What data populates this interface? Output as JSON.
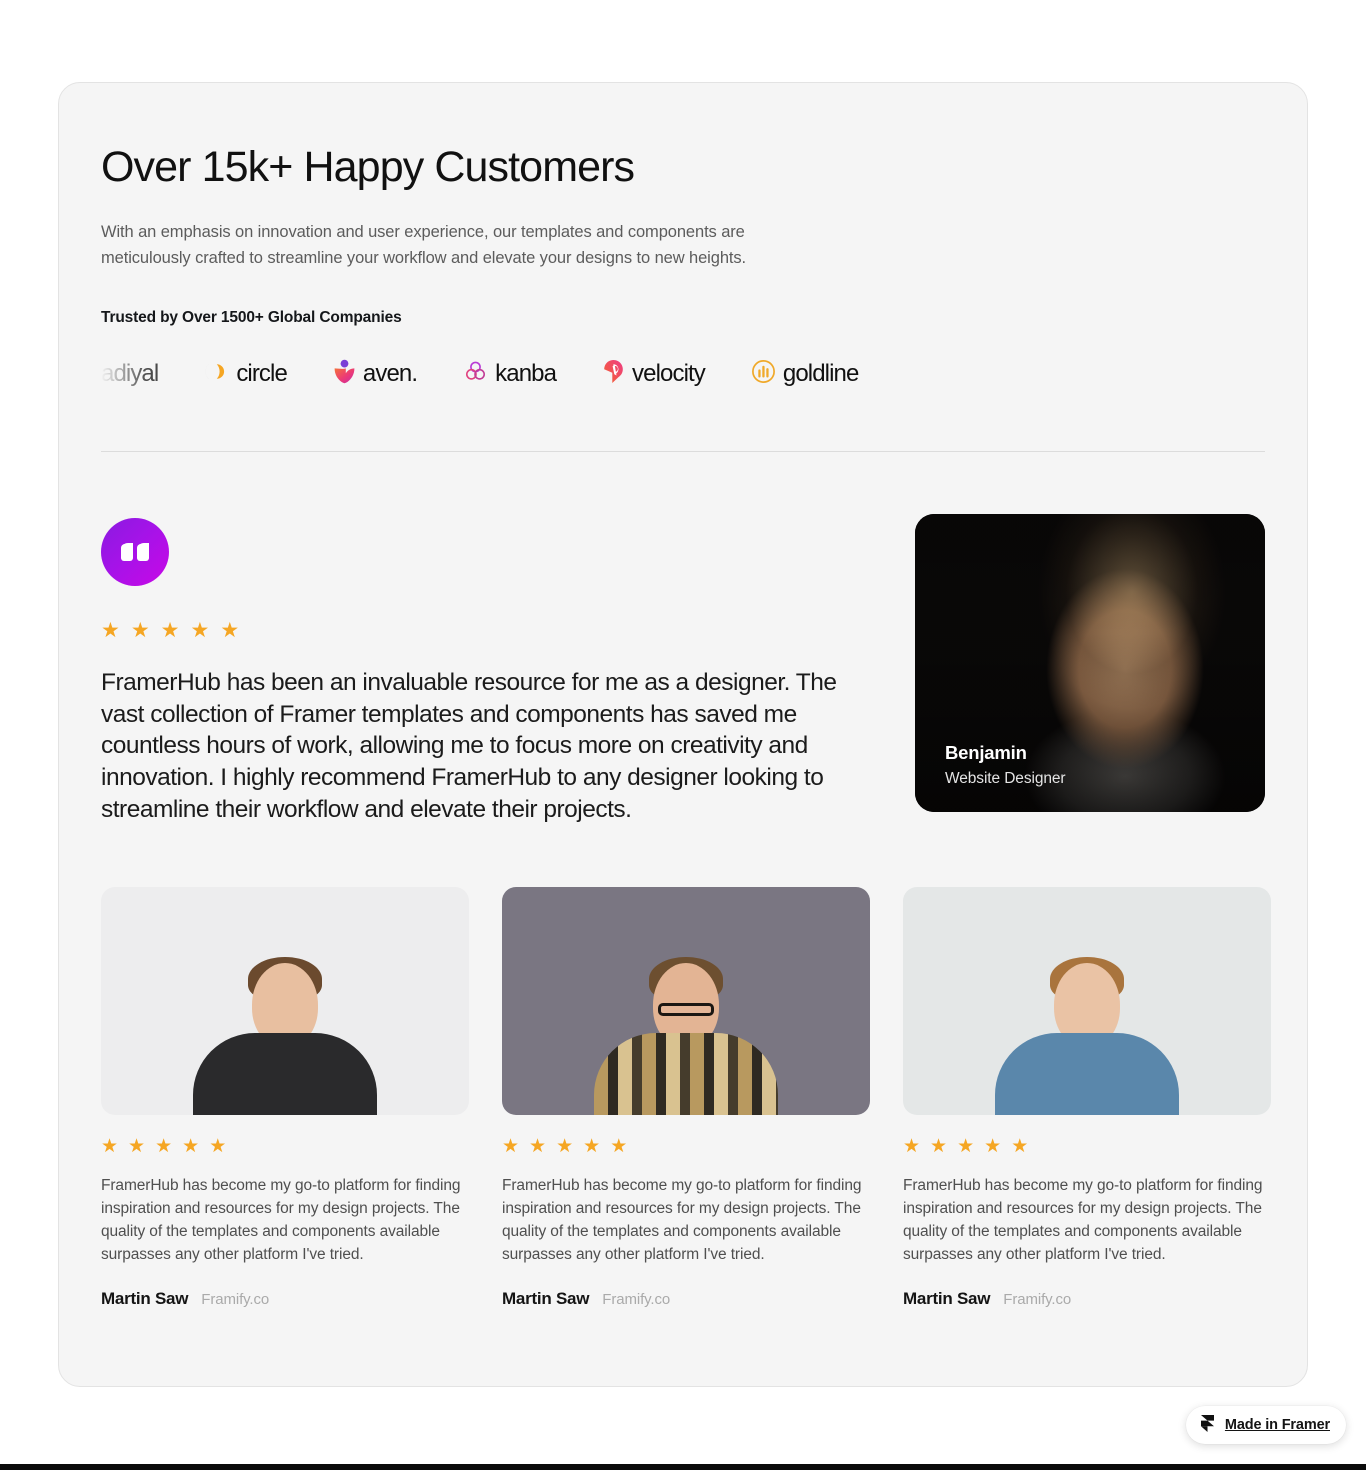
{
  "section": {
    "headline": "Over 15k+ Happy Customers",
    "subhead": "With an emphasis on innovation and user experience, our templates and components are meticulously crafted to streamline your workflow and elevate your designs to new heights.",
    "trusted_label": "Trusted by Over 1500+ Global Companies"
  },
  "logos": [
    {
      "name": "adiyal",
      "icon": "none",
      "accent": "#4a4a4a"
    },
    {
      "name": "circle",
      "icon": "circle-mark-icon",
      "accent": "#F5A623"
    },
    {
      "name": "aven.",
      "icon": "aven-tulip-icon",
      "accent": "#E8457C"
    },
    {
      "name": "kanba",
      "icon": "kanba-rings-icon",
      "accent": "#C23C96"
    },
    {
      "name": "velocity",
      "icon": "velocity-badge-icon",
      "accent": "#F0476B"
    },
    {
      "name": "goldline",
      "icon": "goldline-bars-icon",
      "accent": "#F0A92A"
    }
  ],
  "featured": {
    "quote_icon": "quote-mark-icon",
    "rating": 5,
    "rating_stars": [
      "★",
      "★",
      "★",
      "★",
      "★"
    ],
    "quote": "FramerHub has been an invaluable resource for me as a designer. The vast collection of Framer templates and components has saved me countless hours of work, allowing me to focus more on creativity and innovation. I highly recommend FramerHub to any designer looking to streamline their workflow and elevate their projects.",
    "person": {
      "name": "Benjamin",
      "role": "Website Designer"
    }
  },
  "testimonials": [
    {
      "rating": 5,
      "rating_stars": [
        "★",
        "★",
        "★",
        "★",
        "★"
      ],
      "text": "FramerHub has become my go-to platform for finding inspiration and resources for my design projects. The quality of the templates and components available surpasses any other platform I've tried.",
      "author": "Martin Saw",
      "company": "Framify.co",
      "photo": {
        "background": "#ededee",
        "hair": "#6b4a2e",
        "skin": "#e8bfa0",
        "clothing": "#2a2a2c",
        "glasses": false
      }
    },
    {
      "rating": 5,
      "rating_stars": [
        "★",
        "★",
        "★",
        "★",
        "★"
      ],
      "text": "FramerHub has become my go-to platform for finding inspiration and resources for my design projects. The quality of the templates and components available surpasses any other platform I've tried.",
      "author": "Martin Saw",
      "company": "Framify.co",
      "photo": {
        "background": "#7a7682",
        "hair": "#6d4f30",
        "skin": "#e3b494",
        "clothing": "#b8995f",
        "glasses": true
      }
    },
    {
      "rating": 5,
      "rating_stars": [
        "★",
        "★",
        "★",
        "★",
        "★"
      ],
      "text": "FramerHub has become my go-to platform for finding inspiration and resources for my design projects. The quality of the templates and components available surpasses any other platform I've tried.",
      "author": "Martin Saw",
      "company": "Framify.co",
      "photo": {
        "background": "#e4e7e7",
        "hair": "#a9743d",
        "skin": "#eac3a5",
        "clothing": "#5a87ab",
        "glasses": false
      }
    }
  ],
  "framer_badge": {
    "label": "Made in Framer",
    "icon": "framer-logo-icon"
  },
  "colors": {
    "page_background": "#ffffff",
    "card_background": "#f5f5f5",
    "card_border": "#e3e3e3",
    "star": "#F5A623",
    "quote_badge_gradient_start": "#8A1BE0",
    "quote_badge_gradient_end": "#C808E6",
    "heading": "#111111",
    "body_text": "#5c5c5c",
    "muted_text": "#aaaaaa"
  }
}
